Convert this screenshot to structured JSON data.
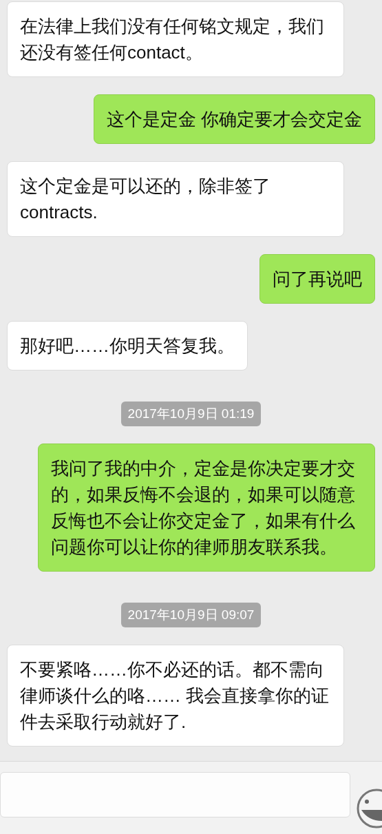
{
  "messages": [
    {
      "kind": "received",
      "text": "在法律上我们没有任何铭文规定，我们还没有签任何contact。"
    },
    {
      "kind": "sent",
      "text": "这个是定金 你确定要才会交定金"
    },
    {
      "kind": "received",
      "text": "这个定金是可以还的，除非签了contracts."
    },
    {
      "kind": "sent",
      "text": "问了再说吧"
    },
    {
      "kind": "received",
      "text": "那好吧……你明天答复我。"
    },
    {
      "kind": "time",
      "text": "2017年10月9日 01:19"
    },
    {
      "kind": "sent",
      "text": "我问了我的中介，定金是你决定要才交的，如果反悔不会退的，如果可以随意反悔也不会让你交定金了，如果有什么问题你可以让你的律师朋友联系我。"
    },
    {
      "kind": "time",
      "text": "2017年10月9日 09:07"
    },
    {
      "kind": "received",
      "text": "不要紧咯……你不必还的话。都不需向律师谈什么的咯…… 我会直接拿你的证件去采取行动就好了."
    }
  ]
}
